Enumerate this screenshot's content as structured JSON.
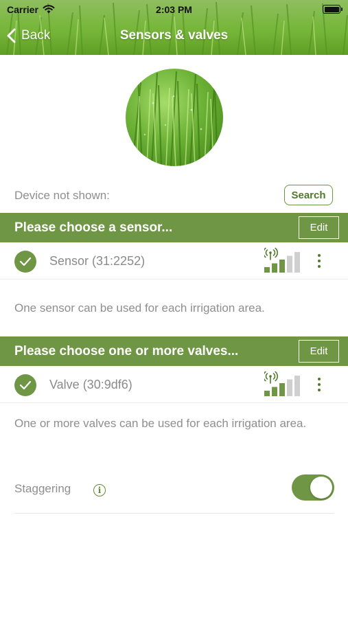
{
  "status_bar": {
    "carrier": "Carrier",
    "time": "2:03 PM",
    "icons": [
      "wifi-icon",
      "battery-icon"
    ]
  },
  "nav": {
    "back_label": "Back",
    "title": "Sensors & valves"
  },
  "device_not_shown": {
    "label": "Device not shown:",
    "search_label": "Search"
  },
  "sensor_section": {
    "title": "Please choose a sensor...",
    "edit_label": "Edit",
    "item": {
      "name": "Sensor (31:2252)",
      "signal_level": 3,
      "signal_max": 5
    },
    "note": "One sensor can be used for each irrigation area."
  },
  "valve_section": {
    "title": "Please choose one or more valves...",
    "edit_label": "Edit",
    "item": {
      "name": "Valve (30:9df6)",
      "signal_level": 3,
      "signal_max": 5
    },
    "note": "One or more valves can be used for each irrigation area."
  },
  "staggering": {
    "label": "Staggering",
    "info_glyph": "i",
    "enabled": true
  },
  "colors": {
    "accent": "#6f9645",
    "accent_dark": "#4f7a2a",
    "muted_text": "#8e8e8e",
    "signal_inactive": "#cfcfcf"
  }
}
